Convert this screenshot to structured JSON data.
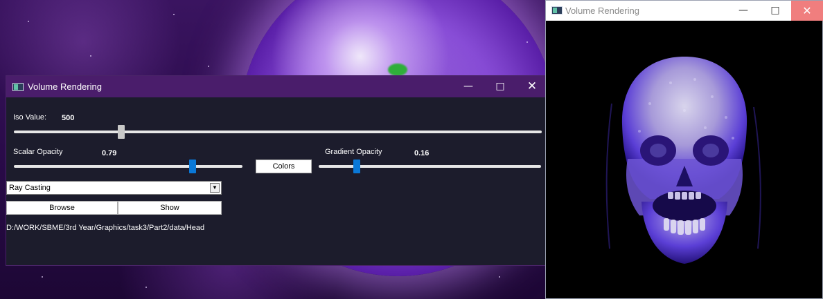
{
  "main_window": {
    "title": "Volume Rendering",
    "iso": {
      "label": "Iso Value:",
      "value": "500",
      "level": 0.2
    },
    "scalar_opacity": {
      "label": "Scalar Opacity",
      "value": "0.79",
      "level": 0.79
    },
    "gradient_opacity": {
      "label": "Gradient Opacity",
      "value": "0.16",
      "level": 0.16
    },
    "colors_button": "Colors",
    "render_mode": {
      "selected": "Ray Casting"
    },
    "browse_button": "Browse",
    "show_button": "Show",
    "path": "D:/WORK/SBME/3rd Year/Graphics/task3/Part2/data/Head"
  },
  "render_window": {
    "title": "Volume Rendering"
  },
  "icons": {
    "minimize": "minimize-icon",
    "maximize": "maximize-icon",
    "close": "close-icon",
    "dropdown": "chevron-down-icon"
  },
  "colors": {
    "main_titlebar": "#4a1d6b",
    "main_bg": "#1c1c2c",
    "slider_accent": "#0a78d7",
    "render_close": "#f07e7e",
    "skull_tint": "#5b3fd6"
  }
}
